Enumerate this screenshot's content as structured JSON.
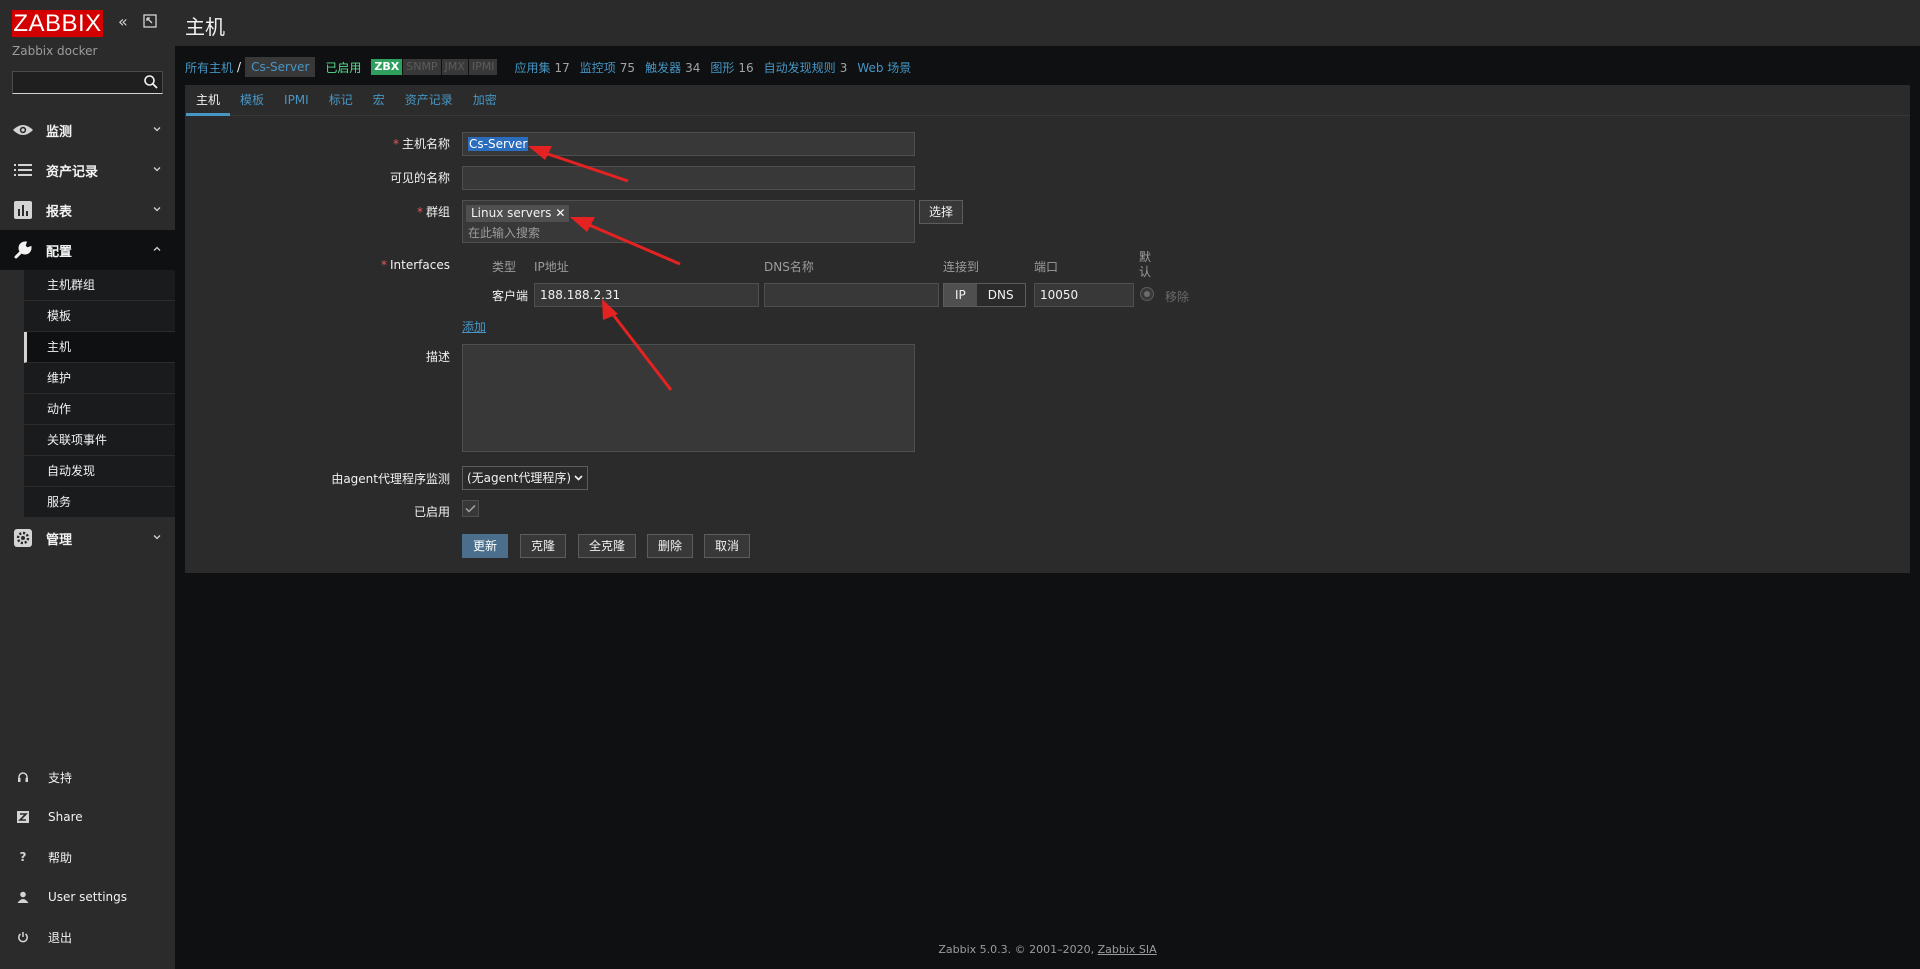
{
  "brand": {
    "logo": "ZABBIX",
    "server_name": "Zabbix docker"
  },
  "sidebar": {
    "menu": [
      {
        "label": "监测",
        "icon": "eye-icon"
      },
      {
        "label": "资产记录",
        "icon": "list-icon"
      },
      {
        "label": "报表",
        "icon": "bar-chart-icon"
      },
      {
        "label": "配置",
        "icon": "wrench-icon"
      }
    ],
    "config_submenu": [
      "主机群组",
      "模板",
      "主机",
      "维护",
      "动作",
      "关联项事件",
      "自动发现",
      "服务"
    ],
    "admin": {
      "label": "管理",
      "icon": "gear-icon"
    },
    "bottom": [
      {
        "label": "支持",
        "icon": "headset-icon"
      },
      {
        "label": "Share",
        "icon": "share-icon"
      },
      {
        "label": "帮助",
        "icon": "help-icon"
      },
      {
        "label": "User settings",
        "icon": "user-icon"
      },
      {
        "label": "退出",
        "icon": "power-icon"
      }
    ]
  },
  "header": {
    "title": "主机"
  },
  "breadcrumb": {
    "all_hosts": "所有主机",
    "separator": "/",
    "current": "Cs-Server",
    "status": "已启用",
    "availability": [
      "ZBX",
      "SNMP",
      "JMX",
      "IPMI"
    ],
    "links": [
      {
        "label": "应用集",
        "count": "17"
      },
      {
        "label": "监控项",
        "count": "75"
      },
      {
        "label": "触发器",
        "count": "34"
      },
      {
        "label": "图形",
        "count": "16"
      },
      {
        "label": "自动发现规则",
        "count": "3"
      },
      {
        "label": "Web 场景",
        "count": ""
      }
    ]
  },
  "tabs": [
    "主机",
    "模板",
    "IPMI",
    "标记",
    "宏",
    "资产记录",
    "加密"
  ],
  "form": {
    "host_name_label": "主机名称",
    "host_name_value": "Cs-Server",
    "visible_name_label": "可见的名称",
    "visible_name_value": "",
    "groups_label": "群组",
    "group_chip": "Linux servers",
    "groups_placeholder": "在此输入搜索",
    "select_button": "选择",
    "interfaces_label": "Interfaces",
    "if_headers": {
      "type": "类型",
      "ip": "IP地址",
      "dns": "DNS名称",
      "connect": "连接到",
      "port": "端口",
      "default": "默认"
    },
    "interface": {
      "type": "客户端",
      "ip": "188.188.2.31",
      "dns": "",
      "ip_btn": "IP",
      "dns_btn": "DNS",
      "port": "10050",
      "remove": "移除"
    },
    "add_link": "添加",
    "description_label": "描述",
    "proxy_label": "由agent代理程序监测",
    "proxy_value": "(无agent代理程序)",
    "enabled_label": "已启用",
    "enabled": true,
    "buttons": {
      "update": "更新",
      "clone": "克隆",
      "full_clone": "全克隆",
      "delete": "删除",
      "cancel": "取消"
    }
  },
  "footer": {
    "text": "Zabbix 5.0.3. © 2001–2020, ",
    "company": "Zabbix SIA"
  },
  "colors": {
    "brand_red": "#d40000",
    "link_blue": "#4796c4",
    "enabled_green": "#59db8f",
    "annotation_red": "#e52222"
  }
}
